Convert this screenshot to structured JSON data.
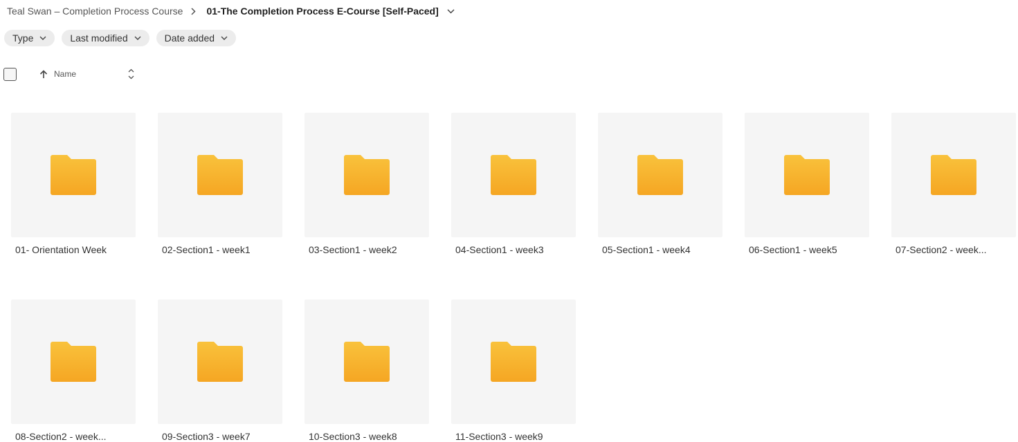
{
  "breadcrumb": {
    "parent": "Teal Swan – Completion Process Course",
    "current": "01-The Completion Process E-Course [Self-Paced]"
  },
  "filters": [
    {
      "label": "Type"
    },
    {
      "label": "Last modified"
    },
    {
      "label": "Date added"
    }
  ],
  "sort": {
    "label": "Name",
    "direction": "ascending"
  },
  "folders": [
    {
      "name": "01- Orientation Week"
    },
    {
      "name": "02-Section1 - week1"
    },
    {
      "name": "03-Section1 - week2"
    },
    {
      "name": "04-Section1 - week3"
    },
    {
      "name": "05-Section1 - week4"
    },
    {
      "name": "06-Section1 - week5"
    },
    {
      "name": "07-Section2 - week..."
    },
    {
      "name": "08-Section2 - week..."
    },
    {
      "name": "09-Section3 - week7"
    },
    {
      "name": "10-Section3 - week8"
    },
    {
      "name": "11-Section3 - week9"
    }
  ],
  "colors": {
    "folder_top": "#F9C23C",
    "folder_bottom": "#F5A623",
    "tile_bg": "#F5F5F5",
    "chip_bg": "#ECECEC"
  },
  "icons": {
    "folder": "folder-icon",
    "chevron": "chevron-down-icon",
    "separator": "chevron-right-icon",
    "sort": "arrow-up-icon",
    "sort_toggle": "sort-toggle-icon"
  }
}
